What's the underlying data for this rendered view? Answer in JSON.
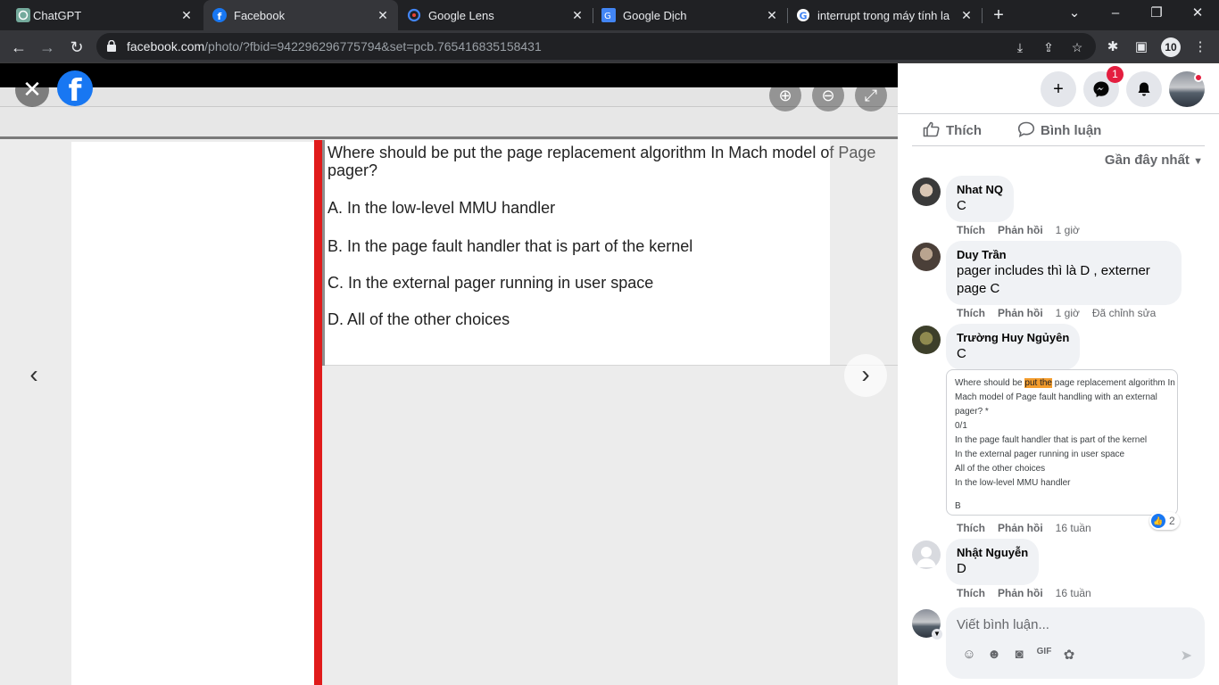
{
  "browser": {
    "tabs": [
      {
        "title": "ChatGPT",
        "active": false
      },
      {
        "title": "Facebook",
        "active": true
      },
      {
        "title": "Google Lens",
        "active": false
      },
      {
        "title": "Google Dịch",
        "active": false
      },
      {
        "title": "interrupt trong máy tính la gì",
        "active": false
      }
    ],
    "url_host": "facebook.com",
    "url_path": "/photo/?fbid=942296296775794&set=pcb.765416835158431",
    "profile_badge": "10"
  },
  "photo": {
    "question_line1": "Where should be put the page replacement algorithm In Mach model of Page",
    "question_line2": "pager?",
    "options": [
      "A.  In the low-level MMU handler",
      "B.  In the page fault handler that is part of the kernel",
      "C.  In the external pager running in user space",
      "D.  All of the other choices"
    ]
  },
  "panel": {
    "messenger_badge": "1",
    "like_label": "Thích",
    "comment_label": "Bình luận",
    "sort_label": "Gần đây nhất",
    "comments": [
      {
        "name": "Nhat NQ",
        "text": "C",
        "like": "Thích",
        "reply": "Phản hồi",
        "time": "1 giờ",
        "edited": ""
      },
      {
        "name": "Duy Trần",
        "text": "pager includes thì là D , externer page C",
        "like": "Thích",
        "reply": "Phản hồi",
        "time": "1 giờ",
        "edited": "Đã chỉnh sửa"
      },
      {
        "name": "Trường Huy Ngủyên",
        "text": "C",
        "like": "Thích",
        "reply": "Phản hồi",
        "time": "16 tuần",
        "edited": ""
      },
      {
        "name": "Nhật Nguyễn",
        "text": "D",
        "like": "Thích",
        "reply": "Phản hồi",
        "time": "16 tuần",
        "edited": ""
      }
    ],
    "attachment": {
      "line1_pre": "Where should be ",
      "line1_hl": "put the",
      "line1_post": " page replacement algorithm In",
      "line2": "Mach model of Page fault handling with an external",
      "line3": "pager? *",
      "line4": "0/1",
      "line5": "In the page fault handler that is part of the kernel",
      "line6": "In the external pager running in user space",
      "line7": "All of the other choices",
      "line8": "In the low-level MMU handler",
      "line9": "B"
    },
    "reaction_count": "2",
    "compose_placeholder": "Viết bình luận..."
  }
}
